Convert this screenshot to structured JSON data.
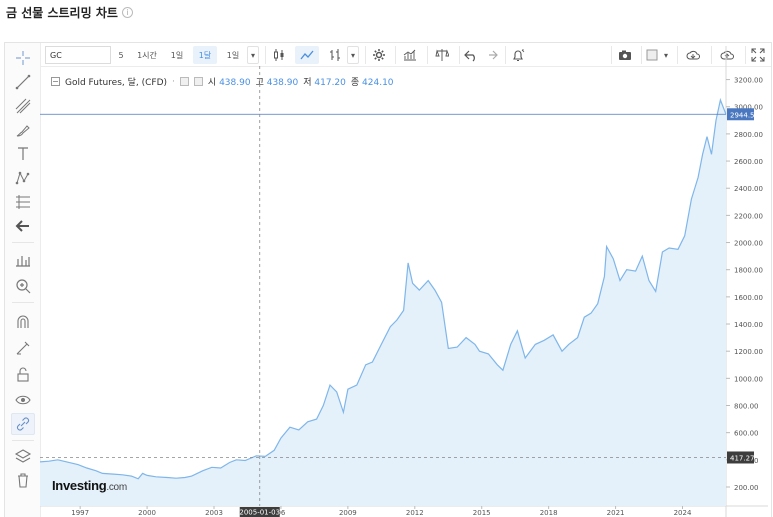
{
  "page": {
    "title": "금 선물 스트리밍 차트",
    "info_glyph": "i"
  },
  "toolbar": {
    "symbol": "GC",
    "timeframes": [
      {
        "label": "5",
        "active": false
      },
      {
        "label": "1시간",
        "active": false
      },
      {
        "label": "1일",
        "active": false
      },
      {
        "label": "1달",
        "active": true
      },
      {
        "label": "1일",
        "active": false
      }
    ],
    "dropdown_caret": "▾"
  },
  "legend": {
    "name": "Gold Futures, 달, (CFD)",
    "dot": "·",
    "open_label": "시",
    "open": "438.90",
    "high_label": "고",
    "high": "438.90",
    "low_label": "저",
    "low": "417.20",
    "close_label": "종",
    "close": "424.10"
  },
  "crosshair": {
    "date_label": "2005-01-03"
  },
  "price_tags": {
    "last": "2944.56",
    "hover": "417.27"
  },
  "logo": {
    "main": "Investing",
    "suffix": ".com"
  },
  "colors": {
    "line": "#7fb6ea",
    "fill": "#e4f1fb",
    "accent": "#4a90e2",
    "tag_blue": "#4a78c0",
    "tag_dark": "#3d3d3d"
  },
  "chart_data": {
    "type": "area",
    "title": "",
    "xlabel": "",
    "ylabel": "",
    "xlim": [
      1995.2,
      2025.95
    ],
    "ylim": [
      60,
      3300
    ],
    "y_ticks": [
      200,
      400,
      600,
      800,
      1000,
      1200,
      1400,
      1600,
      1800,
      2000,
      2200,
      2400,
      2600,
      2800,
      3000,
      3200
    ],
    "x_ticks": [
      {
        "value": 1997,
        "label": "1997"
      },
      {
        "value": 2000,
        "label": "2000"
      },
      {
        "value": 2003,
        "label": "2003"
      },
      {
        "value": 2006,
        "label": "06"
      },
      {
        "value": 2009,
        "label": "2009"
      },
      {
        "value": 2012,
        "label": "2012"
      },
      {
        "value": 2015,
        "label": "2015"
      },
      {
        "value": 2018,
        "label": "2018"
      },
      {
        "value": 2021,
        "label": "2021"
      },
      {
        "value": 2024,
        "label": "2024"
      }
    ],
    "series": [
      {
        "x": [
          1995.2,
          1995.6,
          1996.0,
          1996.4,
          1996.9,
          1997.3,
          1997.7,
          1998.0,
          1998.5,
          1998.9,
          1999.3,
          1999.6,
          1999.8,
          2000.0,
          2000.4,
          2000.9,
          2001.3,
          2001.7,
          2002.0,
          2002.5,
          2002.9,
          2003.3,
          2003.7,
          2004.0,
          2004.4,
          2004.9,
          2005.3,
          2005.7,
          2006.0,
          2006.4,
          2006.8,
          2007.2,
          2007.6,
          2007.9,
          2008.2,
          2008.5,
          2008.8,
          2009.0,
          2009.4,
          2009.8,
          2010.1,
          2010.5,
          2010.9,
          2011.2,
          2011.5,
          2011.7,
          2011.9,
          2012.2,
          2012.6,
          2012.9,
          2013.2,
          2013.5,
          2013.9,
          2014.3,
          2014.7,
          2014.9,
          2015.3,
          2015.7,
          2015.95,
          2016.3,
          2016.6,
          2016.95,
          2017.4,
          2017.8,
          2018.2,
          2018.6,
          2018.9,
          2019.3,
          2019.6,
          2019.9,
          2020.2,
          2020.5,
          2020.6,
          2020.9,
          2021.2,
          2021.5,
          2021.9,
          2022.2,
          2022.5,
          2022.8,
          2023.1,
          2023.4,
          2023.8,
          2024.1,
          2024.4,
          2024.7,
          2024.9,
          2025.1,
          2025.3,
          2025.5,
          2025.7,
          2025.95
        ],
        "values": [
          385,
          390,
          400,
          385,
          365,
          340,
          320,
          300,
          295,
          290,
          280,
          260,
          300,
          285,
          275,
          270,
          265,
          270,
          280,
          320,
          345,
          340,
          380,
          400,
          395,
          430,
          425,
          470,
          560,
          640,
          620,
          680,
          700,
          800,
          950,
          900,
          750,
          920,
          950,
          1100,
          1120,
          1250,
          1380,
          1430,
          1500,
          1850,
          1700,
          1650,
          1720,
          1650,
          1560,
          1220,
          1230,
          1300,
          1250,
          1200,
          1180,
          1100,
          1060,
          1250,
          1350,
          1150,
          1250,
          1280,
          1320,
          1200,
          1250,
          1300,
          1450,
          1480,
          1550,
          1750,
          1970,
          1880,
          1720,
          1800,
          1790,
          1900,
          1720,
          1640,
          1930,
          1960,
          1950,
          2050,
          2320,
          2480,
          2650,
          2780,
          2650,
          2900,
          3050,
          2944
        ]
      }
    ]
  }
}
